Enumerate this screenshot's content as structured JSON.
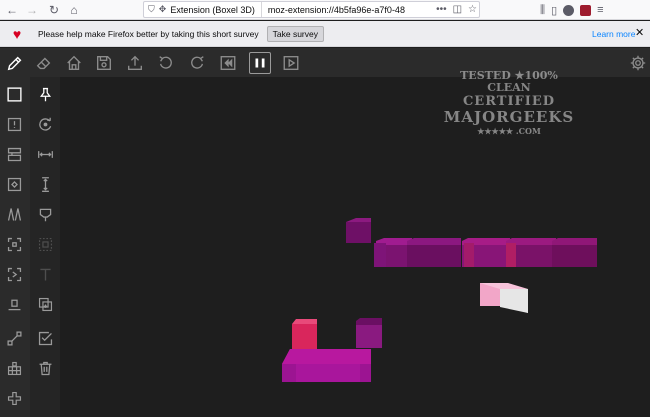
{
  "browser": {
    "ext_label": "Extension (Boxel 3D)",
    "url": "moz-extension://4b5fa96e-a7f0-48",
    "url_more": "•••"
  },
  "notification": {
    "message": "Please help make Firefox better by taking this short survey",
    "button": "Take survey",
    "learn_more": "Learn more"
  },
  "watermark": {
    "line1": "TESTED ★100% CLEAN",
    "line2": "CERTIFIED",
    "line3": "MAJORGEEKS",
    "line4": "★★★★★ .COM"
  },
  "toolbar_icons": [
    "pencil-icon",
    "eraser-icon",
    "home-icon",
    "save-icon",
    "export-icon",
    "undo-icon",
    "redo-icon",
    "rewind-icon",
    "pause-icon",
    "play-icon",
    "gear-icon"
  ],
  "colors": {
    "accent_magenta": "#8a1a7a",
    "pink": "#f2a6c8",
    "red": "#d9265c",
    "background": "#1e1e1e"
  }
}
